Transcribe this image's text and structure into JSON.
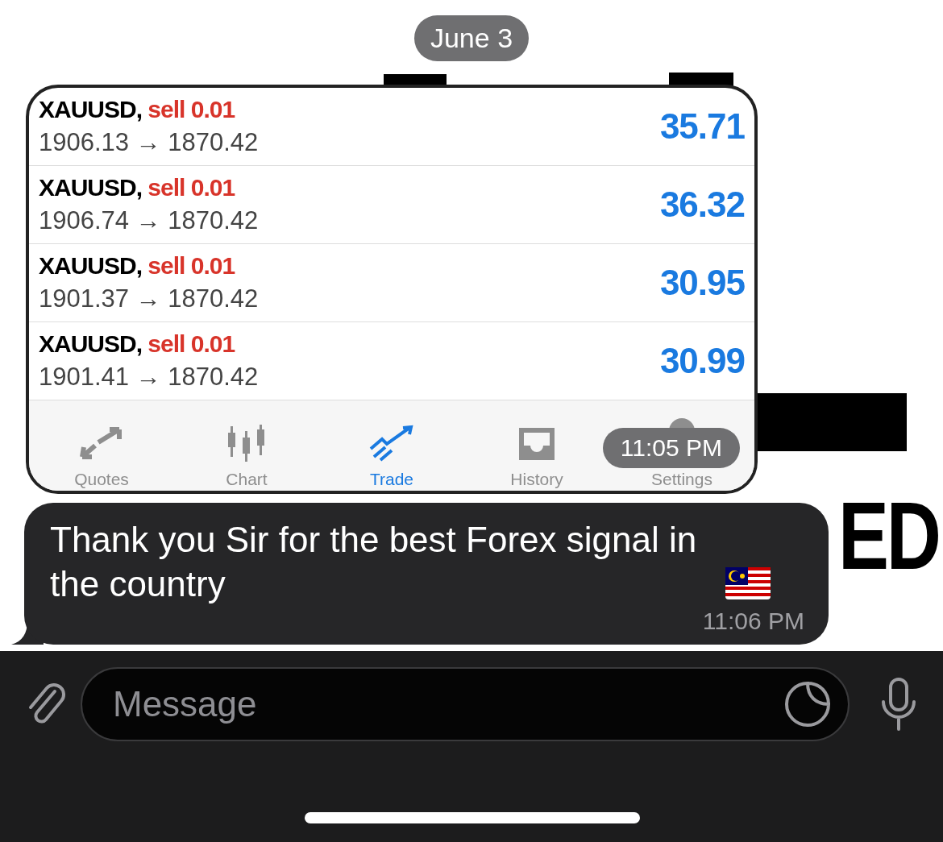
{
  "date_label": "June 3",
  "screenshot": {
    "positions": [
      {
        "symbol": "XAUUSD,",
        "side": "sell 0.01",
        "prices": "1906.13 → 1870.42",
        "profit": "35.71"
      },
      {
        "symbol": "XAUUSD,",
        "side": "sell 0.01",
        "prices": "1906.74 → 1870.42",
        "profit": "36.32"
      },
      {
        "symbol": "XAUUSD,",
        "side": "sell 0.01",
        "prices": "1901.37 → 1870.42",
        "profit": "30.95"
      },
      {
        "symbol": "XAUUSD,",
        "side": "sell 0.01",
        "prices": "1901.41 → 1870.42",
        "profit": "30.99"
      }
    ],
    "tabs": [
      {
        "label": "Quotes",
        "kind": "quotes",
        "selected": false
      },
      {
        "label": "Chart",
        "kind": "chart",
        "selected": false
      },
      {
        "label": "Trade",
        "kind": "trade",
        "selected": true
      },
      {
        "label": "History",
        "kind": "history",
        "selected": false
      },
      {
        "label": "Settings",
        "kind": "settings",
        "selected": false
      }
    ],
    "timestamp": "11:05 PM"
  },
  "message": {
    "text": "Thank you Sir for the best Forex signal in the country",
    "time": "11:06 PM"
  },
  "wallpaper": {
    "text": "ED"
  },
  "composer": {
    "placeholder": "Message"
  }
}
